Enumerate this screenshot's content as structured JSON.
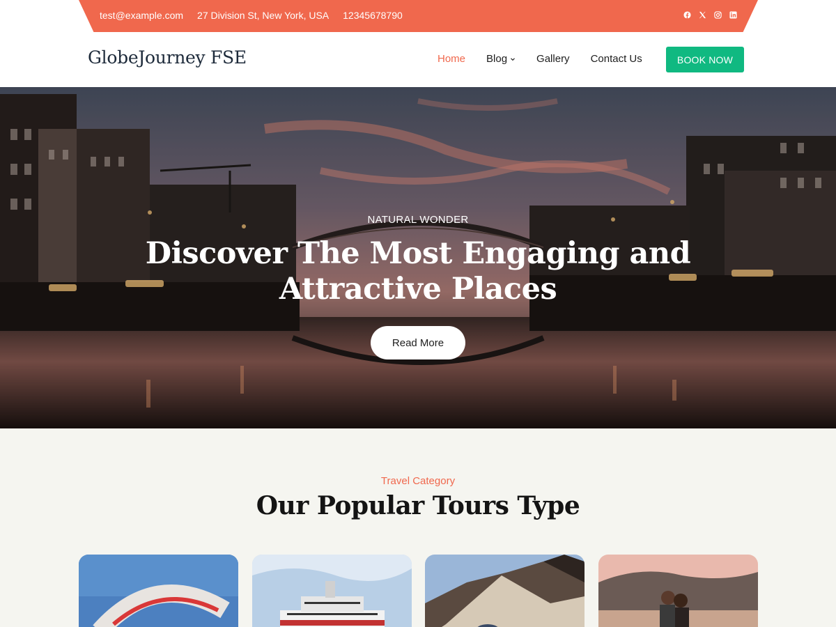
{
  "topbar": {
    "email": "test@example.com",
    "address": "27 Division St, New York, USA",
    "phone": "12345678790",
    "socials": [
      "facebook-icon",
      "x-icon",
      "instagram-icon",
      "linkedin-icon"
    ],
    "color": "#f0684d"
  },
  "header": {
    "logo": "GlobeJourney FSE",
    "nav": [
      {
        "label": "Home",
        "active": true
      },
      {
        "label": "Blog",
        "has_dropdown": true
      },
      {
        "label": "Gallery"
      },
      {
        "label": "Contact Us"
      }
    ],
    "cta": "BOOK NOW",
    "cta_color": "#10b981"
  },
  "hero": {
    "kicker": "NATURAL WONDER",
    "title": "Discover The Most Engaging and Attractive Places",
    "button": "Read More"
  },
  "section": {
    "kicker": "Travel Category",
    "title": "Our Popular Tours Type",
    "cards": [
      "paragliding-image",
      "cruise-ship-image",
      "mountain-hiking-image",
      "beach-couple-image"
    ]
  }
}
